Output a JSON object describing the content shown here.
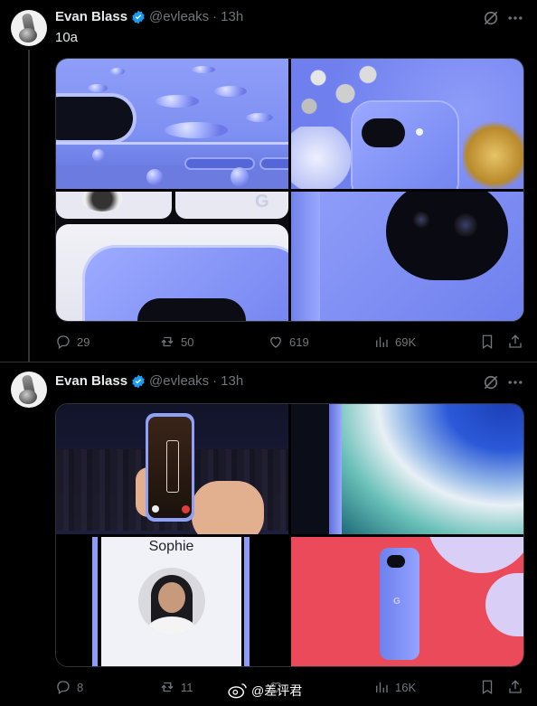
{
  "tweets": [
    {
      "author": "Evan Blass",
      "handle": "@evleaks",
      "time": "13h",
      "separator": "·",
      "text": "10a",
      "stats": {
        "replies": "29",
        "reposts": "50",
        "likes": "619",
        "views": "69K"
      }
    },
    {
      "author": "Evan Blass",
      "handle": "@evleaks",
      "time": "13h",
      "separator": "·",
      "text": "",
      "card_label": "Sophie",
      "stats": {
        "replies": "8",
        "reposts": "11",
        "likes": "",
        "views": "16K"
      }
    }
  ],
  "watermark": {
    "text": "@差评君"
  },
  "colors": {
    "background": "#000000",
    "accent": "#1d9bf0",
    "muted": "#71767b",
    "phone_blue": "#7c8ef5"
  }
}
